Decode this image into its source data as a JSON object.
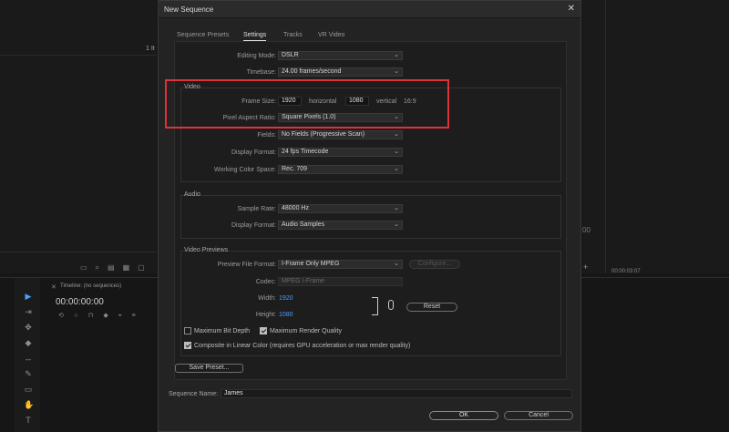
{
  "background": {
    "panel_count": "1 It",
    "timeline_tab": "Timeline: (no sequences)",
    "timecode": "00:00:00:00",
    "right_timecode": "00:00:03:07",
    "partial_digits": "00"
  },
  "dialog": {
    "title": "New Sequence",
    "tabs": [
      {
        "label": "Sequence Presets"
      },
      {
        "label": "Settings"
      },
      {
        "label": "Tracks"
      },
      {
        "label": "VR Video"
      }
    ],
    "editing_mode": {
      "label": "Editing Mode:",
      "value": "DSLR"
    },
    "timebase": {
      "label": "Timebase:",
      "value": "24.00  frames/second"
    },
    "video": {
      "group_label": "Video",
      "frame_size_label": "Frame Size:",
      "frame_width": "1920",
      "horizontal_label": "horizontal",
      "frame_height": "1080",
      "vertical_label": "vertical",
      "aspect": "16:9",
      "par_label": "Pixel Aspect Ratio:",
      "par_value": "Square Pixels (1.0)",
      "fields_label": "Fields:",
      "fields_value": "No Fields (Progressive Scan)",
      "display_format_label": "Display Format:",
      "display_format_value": "24 fps Timecode",
      "working_color_label": "Working Color Space:",
      "working_color_value": "Rec. 709"
    },
    "audio": {
      "group_label": "Audio",
      "sample_rate_label": "Sample Rate:",
      "sample_rate_value": "48000 Hz",
      "display_format_label": "Display Format:",
      "display_format_value": "Audio Samples"
    },
    "previews": {
      "group_label": "Video Previews",
      "file_format_label": "Preview File Format:",
      "file_format_value": "I-Frame Only MPEG",
      "configure_label": "Configure...",
      "codec_label": "Codec:",
      "codec_value": "MPEG I-Frame",
      "width_label": "Width:",
      "width_value": "1920",
      "height_label": "Height:",
      "height_value": "1080",
      "reset_label": "Reset"
    },
    "checkboxes": {
      "max_bit_depth": {
        "label": "Maximum Bit Depth",
        "checked": false
      },
      "max_render_quality": {
        "label": "Maximum Render Quality",
        "checked": true
      },
      "composite_linear": {
        "label": "Composite in Linear Color (requires GPU acceleration or max render quality)",
        "checked": true
      }
    },
    "save_preset_label": "Save Preset...",
    "sequence_name_label": "Sequence Name:",
    "sequence_name_value": "James",
    "ok_label": "OK",
    "cancel_label": "Cancel"
  },
  "colors": {
    "highlight": "#e0323a",
    "accent_blue": "#4a9eff"
  }
}
